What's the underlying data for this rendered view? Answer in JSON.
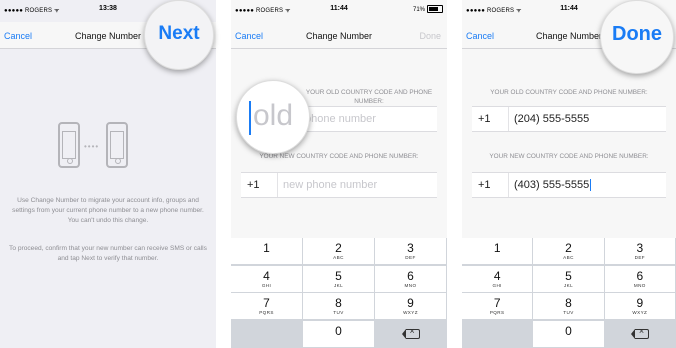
{
  "panel1": {
    "status": {
      "carrier": "●●●●● ROGERS ᯤ",
      "time": "13:38"
    },
    "nav": {
      "cancel": "Cancel",
      "title": "Change Number",
      "next": "Next"
    },
    "icons": {
      "phone_left": "iphone-icon",
      "phone_right": "iphone-icon",
      "dots": "••••"
    },
    "para1": "Use Change Number to migrate your account info, groups and settings from your current phone number to a new phone number. You can't undo this change.",
    "para2": "To proceed, confirm that your new number can receive SMS or calls and tap Next to verify that number."
  },
  "panel2": {
    "status": {
      "carrier": "●●●●● ROGERS ᯤ",
      "time": "11:44",
      "battery": "71%"
    },
    "nav": {
      "cancel": "Cancel",
      "title": "Change Number",
      "done": "Done"
    },
    "old_label": "Your old country code and phone number:",
    "old_placeholder": "phone number",
    "magnified_placeholder": "old",
    "new_label": "Your new country code and phone number:",
    "new_code": "+1",
    "new_placeholder": "new phone number"
  },
  "panel3": {
    "status": {
      "carrier": "●●●●● ROGERS ᯤ",
      "time": "11:44"
    },
    "nav": {
      "cancel": "Cancel",
      "title": "Change Number",
      "done": "Done"
    },
    "old_label": "Your old country code and phone number:",
    "old_code": "+1",
    "old_number": "(204) 555-5555",
    "new_label": "Your new country code and phone number:",
    "new_code": "+1",
    "new_number": "(403) 555-5555"
  },
  "keypad": {
    "keys": [
      {
        "n": "1",
        "l": ""
      },
      {
        "n": "2",
        "l": "ABC"
      },
      {
        "n": "3",
        "l": "DEF"
      },
      {
        "n": "4",
        "l": "GHI"
      },
      {
        "n": "5",
        "l": "JKL"
      },
      {
        "n": "6",
        "l": "MNO"
      },
      {
        "n": "7",
        "l": "PQRS"
      },
      {
        "n": "8",
        "l": "TUV"
      },
      {
        "n": "9",
        "l": "WXYZ"
      },
      {
        "n": "",
        "l": ""
      },
      {
        "n": "0",
        "l": ""
      },
      {
        "n": "",
        "l": ""
      }
    ],
    "delete_icon": "backspace-icon"
  },
  "colors": {
    "accent": "#1a7cf5",
    "placeholder": "#c7c7cc",
    "secondary_text": "#8e8e93",
    "keypad_bg": "#d1d5db"
  }
}
